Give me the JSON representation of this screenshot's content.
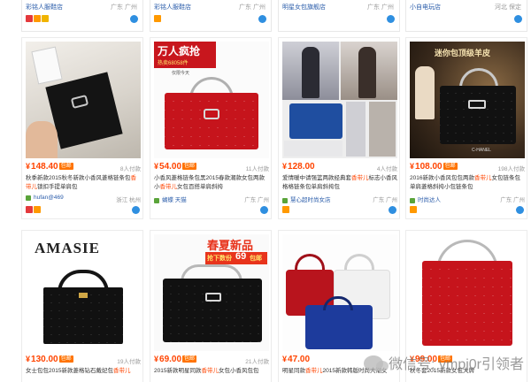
{
  "top_row": [
    {
      "shop": "彩铭人服鞋店",
      "location": "广东 广州"
    },
    {
      "shop": "彩铭人服鞋店",
      "location": "广东 广州"
    },
    {
      "shop": "明星女包旗舰店",
      "location": "广东 广州"
    },
    {
      "shop": "小自电玩店",
      "location": "河北 保定"
    }
  ],
  "products": [
    {
      "price": "148.40",
      "paid": "8人付款",
      "title_pre": "秋季新款2015秋冬新款小香风菱格链条包",
      "title_hl": "香带儿",
      "title_post": "锁扣手提单肩包",
      "shop": "hufan@469",
      "location": "浙江 杭州",
      "tag": "包邮"
    },
    {
      "price": "54.00",
      "paid": "11人付款",
      "title_pre": "小香风菱格链条包黑2015春款潮款女包两款小",
      "title_hl": "香带儿",
      "title_post": "女包百搭单肩斜挎",
      "shop": "蝴蝶 天猫",
      "location": "广东 广州",
      "tag": "包邮",
      "promo_line1": "万人疯抢",
      "promo_line2": "热卖68058件",
      "promo_line3": "仅限今天"
    },
    {
      "price": "128.00",
      "paid": "4人付款",
      "title_pre": "爱情暖中请强篮两款经典套",
      "title_hl": "香带儿",
      "title_post": "标志小香风格格链条包单肩斜挎包",
      "shop": "慧心超时尚女店",
      "location": "广东 广州",
      "tag": ""
    },
    {
      "price": "108.00",
      "paid": "198人付款",
      "title_pre": "2016新款小香风包包两款",
      "title_hl": "香带儿",
      "title_post": "女包链条包单肩菱格斜挎小包链条包",
      "shop": "时尚达人",
      "location": "广东 广州",
      "tag": "包邮",
      "promo_line1": "迷你包顶级羊皮",
      "promo_line2": "C-HANEL"
    },
    {
      "price": "130.00",
      "paid": "19人付款",
      "title_pre": "女士包包2015新款菱格钻石戴妃包",
      "title_hl": "香带儿",
      "title_post": "",
      "shop": "",
      "location": "",
      "tag": "包邮",
      "promo_line1": "AMASIE"
    },
    {
      "price": "69.00",
      "paid": "21人付款",
      "title_pre": "2015新款明星同款",
      "title_hl": "香带儿",
      "title_post": "女包小香风包包",
      "shop": "",
      "location": "",
      "tag": "包邮",
      "promo_line1": "春夏新品",
      "promo_line2": "抢下数份",
      "promo_line3": "69",
      "promo_line4": "包邮"
    },
    {
      "price": "47.00",
      "paid": "",
      "title_pre": "明星同款",
      "title_hl": "香带儿",
      "title_post": "2015新款韩版时尚大潮女",
      "shop": "",
      "location": "",
      "tag": ""
    },
    {
      "price": "99.00",
      "paid": "",
      "title_pre": "秋冬套2015新款女包大牌",
      "title_hl": "",
      "title_post": "",
      "shop": "",
      "location": "",
      "tag": "包邮"
    }
  ],
  "watermark": "微信号: vmpj0r引领者",
  "colors": {
    "price": "#ff4400",
    "tag": "#ff7300",
    "shop_link": "#2a5caa"
  }
}
